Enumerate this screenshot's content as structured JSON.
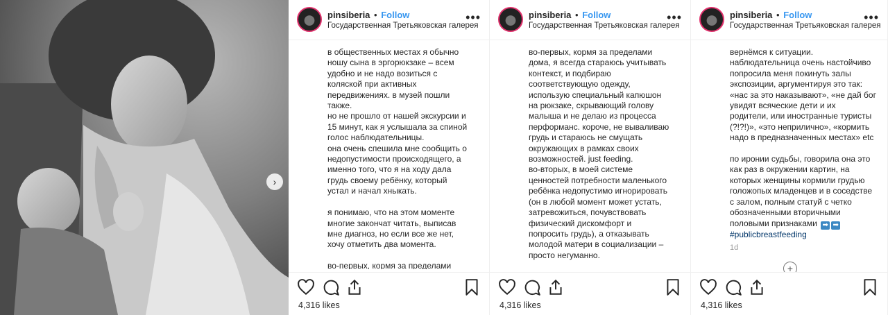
{
  "photo": {
    "alt": "",
    "next_icon": "chevron-right-icon",
    "next_glyph": "›"
  },
  "posts": [
    {
      "username": "pinsiberia",
      "dot": "•",
      "follow_label": "Follow",
      "location": "Государственная Третьяковская галерея",
      "more_label": "•••",
      "caption": "в общественных местах я обычно\nношу сына в эргорюкзаке – всем\nудобно и не надо возиться с\nколяской при активных\nпередвижениях. в музей пошли\nтакже.\nно не прошло от нашей экскурсии и\n15 минут, как я услышала за спиной\nголос наблюдательницы.\nона очень спешила мне сообщить о\nнедопустимости происходящего, а\nименно того, что я на ходу дала\nгрудь своему ребёнку, который\nустал и начал хныкать.\n\nя понимаю, что на этом моменте\nмногие закончат читать, выписав\nмне диагноз, но если все же нет,\nхочу отметить два момента.\n\nво-первых, кормя за пределами",
      "likes": "4,316 likes"
    },
    {
      "username": "pinsiberia",
      "dot": "•",
      "follow_label": "Follow",
      "location": "Государственная Третьяковская галерея",
      "more_label": "•••",
      "caption": "во-первых, кормя за пределами\nдома, я всегда стараюсь учитывать\nконтекст, и подбираю\nсоответствующую одежду,\nиспользую специальный капюшон\nна рюкзаке, скрывающий голову\nмалыша и не делаю из процесса\nперформанс. короче, не вываливаю\nгрудь и стараюсь не смущать\nокружающих в рамках своих\nвозможностей. just feeding.\nво-вторых, в моей системе\nценностей потребности маленького\nребёнка недопустимо игнорировать\n(он в любой момент может устать,\nзатревожиться, почувствовать\nфизический дискомфорт и\nпопросить грудь), а отказывать\nмолодой матери в социализации –\nпросто негуманно.",
      "likes": "4,316 likes"
    },
    {
      "username": "pinsiberia",
      "dot": "•",
      "follow_label": "Follow",
      "location": "Государственная Третьяковская галерея",
      "more_label": "•••",
      "caption": "вернёмся к ситуации.\nнаблюдательница очень настойчиво\nпопросила меня покинуть залы\nэкспозиции, аргументируя это так:\n«нас за это наказывают», «не дай бог\nувидят всяческие дети и их\nродители, или иностранные туристы\n(?!?!)», «это неприлично», «кормить\nнадо в предназначенных местах» etc\n\nпо иронии судьбы, говорила она это\nкак раз в окружении картин, на\nкоторых женщины кормили грудью\nголожопых младенцев и в соседстве\nс залом, полным статуй с четко\nобозначенными вторичными\nполовыми признаками",
      "arrows": [
        "➡",
        "➡"
      ],
      "hashtag": "#publicbreastfeeding",
      "timestamp": "1d",
      "add_comment_label": "+",
      "likes": "4,316 likes"
    }
  ]
}
